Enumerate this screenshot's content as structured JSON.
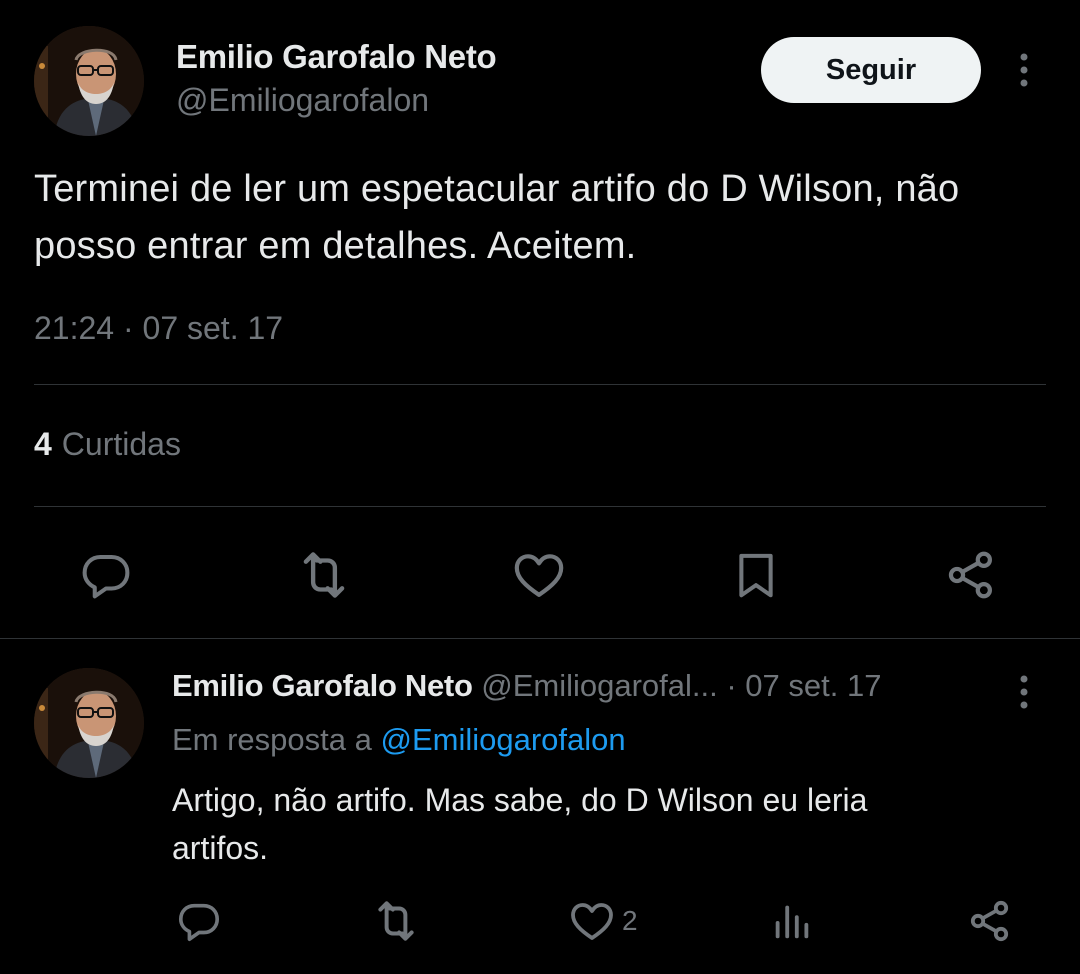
{
  "tweet": {
    "author_name": "Emilio Garofalo Neto",
    "author_handle": "@Emiliogarofalon",
    "follow_label": "Seguir",
    "text": "Terminei de ler um espetacular artifo do D Wilson, não posso entrar em detalhes. Aceitem.",
    "time": "21:24",
    "separator": "·",
    "date": "07 set. 17",
    "likes_count": "4",
    "likes_label": "Curtidas",
    "actions": [
      "reply-icon",
      "retweet-icon",
      "like-icon",
      "bookmark-icon",
      "share-icon"
    ],
    "more_icon": "more-vertical-icon",
    "avatar": "profile-photo"
  },
  "reply": {
    "author_name": "Emilio Garofalo Neto",
    "author_handle": "@Emiliogarofal...",
    "date": "· 07 set. 17",
    "in_reply_prefix": "Em resposta a",
    "in_reply_mention": "@Emiliogarofalon",
    "text": "Artigo, não artifo. Mas sabe, do D Wilson eu leria artifos.",
    "like_count": "2",
    "actions": [
      "reply-icon",
      "retweet-icon",
      "like-icon",
      "views-icon",
      "share-icon"
    ],
    "more_icon": "more-vertical-icon",
    "avatar": "profile-photo"
  },
  "colors": {
    "background": "#000000",
    "text_primary": "#e7e9ea",
    "text_secondary": "#71767b",
    "mention": "#1d9bf0",
    "divider": "#2f3336",
    "follow_bg": "#eff3f4"
  }
}
